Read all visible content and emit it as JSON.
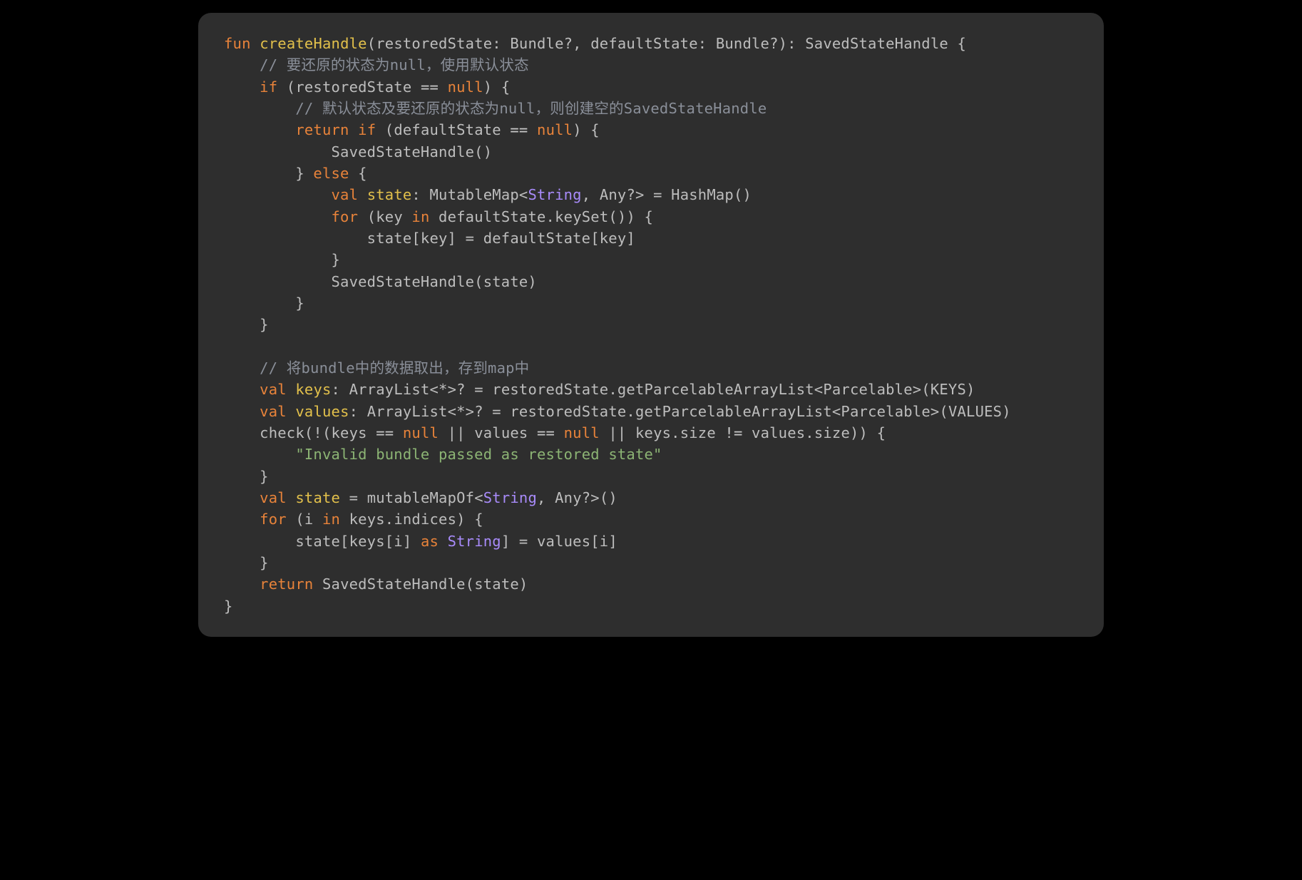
{
  "code": {
    "tokens": [
      [
        [
          "kw",
          "fun"
        ],
        [
          "plain",
          " "
        ],
        [
          "fn-name",
          "createHandle"
        ],
        [
          "plain",
          "(restoredState: Bundle?, defaultState: Bundle?): SavedStateHandle {"
        ]
      ],
      [
        [
          "plain",
          "    "
        ],
        [
          "comment",
          "// 要还原的状态为null，使用默认状态"
        ]
      ],
      [
        [
          "plain",
          "    "
        ],
        [
          "kw",
          "if"
        ],
        [
          "plain",
          " (restoredState "
        ],
        [
          "op",
          "=="
        ],
        [
          "plain",
          " "
        ],
        [
          "null",
          "null"
        ],
        [
          "plain",
          ") {"
        ]
      ],
      [
        [
          "plain",
          "        "
        ],
        [
          "comment",
          "// 默认状态及要还原的状态为null，则创建空的SavedStateHandle"
        ]
      ],
      [
        [
          "plain",
          "        "
        ],
        [
          "kw",
          "return"
        ],
        [
          "plain",
          " "
        ],
        [
          "kw",
          "if"
        ],
        [
          "plain",
          " (defaultState "
        ],
        [
          "op",
          "=="
        ],
        [
          "plain",
          " "
        ],
        [
          "null",
          "null"
        ],
        [
          "plain",
          ") {"
        ]
      ],
      [
        [
          "plain",
          "            SavedStateHandle()"
        ]
      ],
      [
        [
          "plain",
          "        } "
        ],
        [
          "kw",
          "else"
        ],
        [
          "plain",
          " {"
        ]
      ],
      [
        [
          "plain",
          "            "
        ],
        [
          "kw",
          "val"
        ],
        [
          "plain",
          " "
        ],
        [
          "ident",
          "state"
        ],
        [
          "plain",
          ": MutableMap<"
        ],
        [
          "type",
          "String"
        ],
        [
          "plain",
          ", Any?> = HashMap()"
        ]
      ],
      [
        [
          "plain",
          "            "
        ],
        [
          "kw",
          "for"
        ],
        [
          "plain",
          " (key "
        ],
        [
          "kw",
          "in"
        ],
        [
          "plain",
          " defaultState.keySet()) {"
        ]
      ],
      [
        [
          "plain",
          "                state[key] = defaultState[key]"
        ]
      ],
      [
        [
          "plain",
          "            }"
        ]
      ],
      [
        [
          "plain",
          "            SavedStateHandle(state)"
        ]
      ],
      [
        [
          "plain",
          "        }"
        ]
      ],
      [
        [
          "plain",
          "    }"
        ]
      ],
      [
        [
          "plain",
          ""
        ]
      ],
      [
        [
          "plain",
          "    "
        ],
        [
          "comment",
          "// 将bundle中的数据取出，存到map中"
        ]
      ],
      [
        [
          "plain",
          "    "
        ],
        [
          "kw",
          "val"
        ],
        [
          "plain",
          " "
        ],
        [
          "ident",
          "keys"
        ],
        [
          "plain",
          ": ArrayList<*>? = restoredState.getParcelableArrayList<Parcelable>(KEYS)"
        ]
      ],
      [
        [
          "plain",
          "    "
        ],
        [
          "kw",
          "val"
        ],
        [
          "plain",
          " "
        ],
        [
          "ident",
          "values"
        ],
        [
          "plain",
          ": ArrayList<*>? = restoredState.getParcelableArrayList<Parcelable>(VALUES)"
        ]
      ],
      [
        [
          "plain",
          "    check(!(keys "
        ],
        [
          "op",
          "=="
        ],
        [
          "plain",
          " "
        ],
        [
          "null",
          "null"
        ],
        [
          "plain",
          " || values "
        ],
        [
          "op",
          "=="
        ],
        [
          "plain",
          " "
        ],
        [
          "null",
          "null"
        ],
        [
          "plain",
          " || keys.size "
        ],
        [
          "op",
          "!="
        ],
        [
          "plain",
          " values.size)) {"
        ]
      ],
      [
        [
          "plain",
          "        "
        ],
        [
          "str",
          "\"Invalid bundle passed as restored state\""
        ]
      ],
      [
        [
          "plain",
          "    }"
        ]
      ],
      [
        [
          "plain",
          "    "
        ],
        [
          "kw",
          "val"
        ],
        [
          "plain",
          " "
        ],
        [
          "ident",
          "state"
        ],
        [
          "plain",
          " = mutableMapOf<"
        ],
        [
          "type",
          "String"
        ],
        [
          "plain",
          ", Any?>()"
        ]
      ],
      [
        [
          "plain",
          "    "
        ],
        [
          "kw",
          "for"
        ],
        [
          "plain",
          " (i "
        ],
        [
          "kw",
          "in"
        ],
        [
          "plain",
          " keys.indices) {"
        ]
      ],
      [
        [
          "plain",
          "        state[keys[i] "
        ],
        [
          "kw",
          "as"
        ],
        [
          "plain",
          " "
        ],
        [
          "type",
          "String"
        ],
        [
          "plain",
          "] = values[i]"
        ]
      ],
      [
        [
          "plain",
          "    }"
        ]
      ],
      [
        [
          "plain",
          "    "
        ],
        [
          "kw",
          "return"
        ],
        [
          "plain",
          " SavedStateHandle(state)"
        ]
      ],
      [
        [
          "plain",
          "}"
        ]
      ]
    ]
  }
}
